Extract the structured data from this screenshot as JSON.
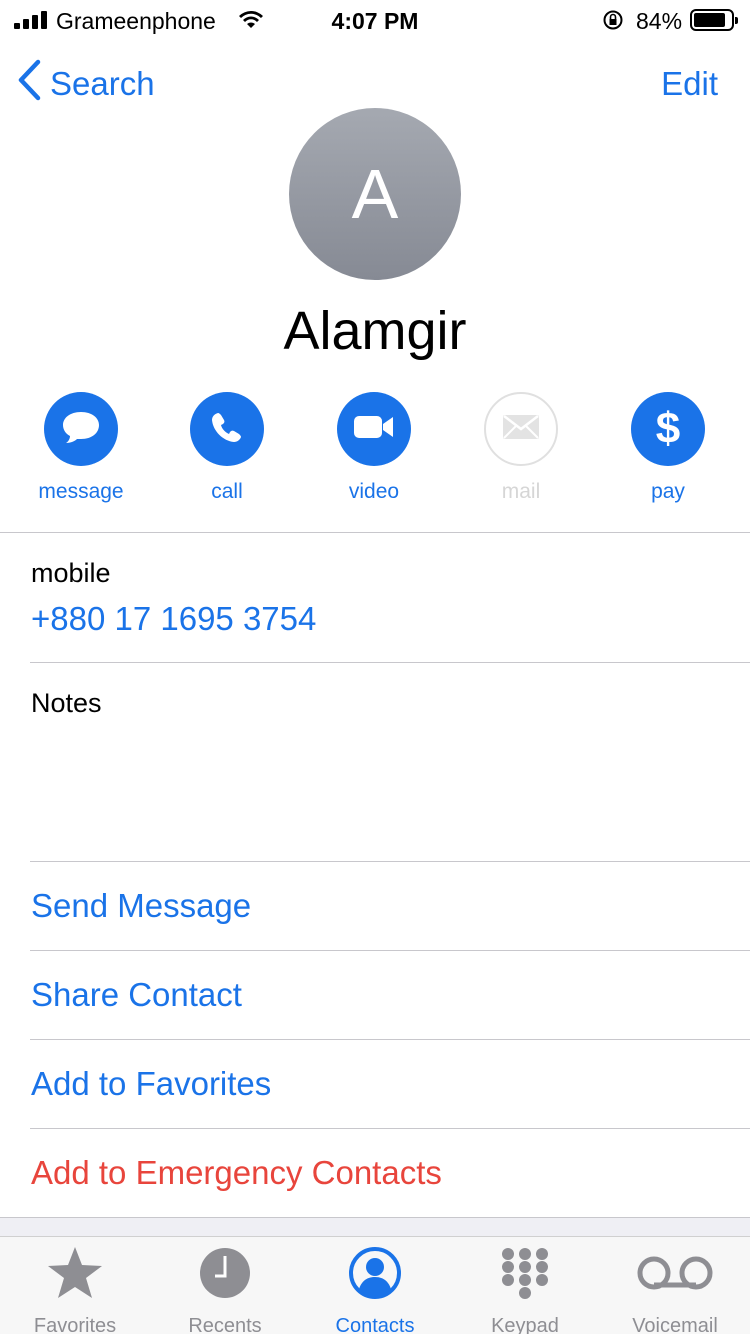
{
  "status_bar": {
    "carrier": "Grameenphone",
    "time": "4:07 PM",
    "battery_percent": "84%"
  },
  "nav": {
    "back_label": "Search",
    "edit_label": "Edit"
  },
  "contact": {
    "initial": "A",
    "name": "Alamgir"
  },
  "actions": [
    {
      "label": "message",
      "icon": "message-bubble-icon",
      "enabled": true
    },
    {
      "label": "call",
      "icon": "phone-icon",
      "enabled": true
    },
    {
      "label": "video",
      "icon": "video-camera-icon",
      "enabled": true
    },
    {
      "label": "mail",
      "icon": "envelope-icon",
      "enabled": false
    },
    {
      "label": "pay",
      "icon": "dollar-icon",
      "enabled": true
    }
  ],
  "phone": {
    "label": "mobile",
    "number": "+880 17 1695 3754"
  },
  "notes": {
    "label": "Notes"
  },
  "links": {
    "send_message": "Send Message",
    "share_contact": "Share Contact",
    "add_favorites": "Add to Favorites",
    "add_emergency": "Add to Emergency Contacts"
  },
  "tabs": [
    {
      "label": "Favorites",
      "icon": "star-icon",
      "active": false
    },
    {
      "label": "Recents",
      "icon": "clock-icon",
      "active": false
    },
    {
      "label": "Contacts",
      "icon": "person-circle-icon",
      "active": true
    },
    {
      "label": "Keypad",
      "icon": "keypad-icon",
      "active": false
    },
    {
      "label": "Voicemail",
      "icon": "voicemail-icon",
      "active": false
    }
  ],
  "colors": {
    "accent": "#1a73e8",
    "destructive": "#e8453c",
    "inactive_tab": "#8e8e93",
    "disabled": "#d6d6d6"
  }
}
